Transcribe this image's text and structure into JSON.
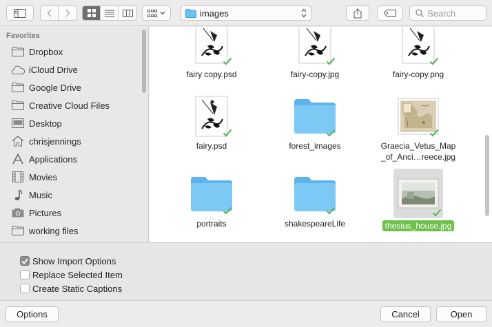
{
  "toolbar": {
    "location": "images",
    "search_placeholder": "Search"
  },
  "sidebar": {
    "heading": "Favorites",
    "items": [
      {
        "label": "Dropbox",
        "icon": "folder-icon"
      },
      {
        "label": "iCloud Drive",
        "icon": "cloud-icon"
      },
      {
        "label": "Google Drive",
        "icon": "folder-icon"
      },
      {
        "label": "Creative Cloud Files",
        "icon": "folder-icon"
      },
      {
        "label": "Desktop",
        "icon": "desktop-icon"
      },
      {
        "label": "chrisjennings",
        "icon": "home-icon"
      },
      {
        "label": "Applications",
        "icon": "applications-icon"
      },
      {
        "label": "Movies",
        "icon": "film-icon"
      },
      {
        "label": "Music",
        "icon": "music-note-icon"
      },
      {
        "label": "Pictures",
        "icon": "camera-icon"
      },
      {
        "label": "working files",
        "icon": "folder-icon"
      }
    ]
  },
  "files": [
    {
      "name": "fairy copy.psd",
      "type": "image-fairy"
    },
    {
      "name": "fairy-copy.jpg",
      "type": "image-fairy"
    },
    {
      "name": "fairy-copy.png",
      "type": "image-fairy"
    },
    {
      "name": "fairy.psd",
      "type": "image-fairy"
    },
    {
      "name": "forest_images",
      "type": "folder"
    },
    {
      "name": "Graecia_Vetus_Map_of_Anci…reece.jpg",
      "name_line1": "Graecia_Vetus_Map",
      "name_line2": "_of_Anci…reece.jpg",
      "type": "image-map"
    },
    {
      "name": "portraits",
      "type": "folder"
    },
    {
      "name": "shakespeareLife",
      "type": "folder"
    },
    {
      "name": "thesius_house.jpg",
      "type": "image-photo",
      "selected": true
    }
  ],
  "options": [
    {
      "label": "Show Import Options",
      "checked": true
    },
    {
      "label": "Replace Selected Item",
      "checked": false
    },
    {
      "label": "Create Static Captions",
      "checked": false
    }
  ],
  "buttons": {
    "options": "Options",
    "cancel": "Cancel",
    "open": "Open"
  },
  "colors": {
    "selection_green": "#6cc04a",
    "folder_blue": "#6ec1f4",
    "sync_check": "#5fb55b"
  }
}
